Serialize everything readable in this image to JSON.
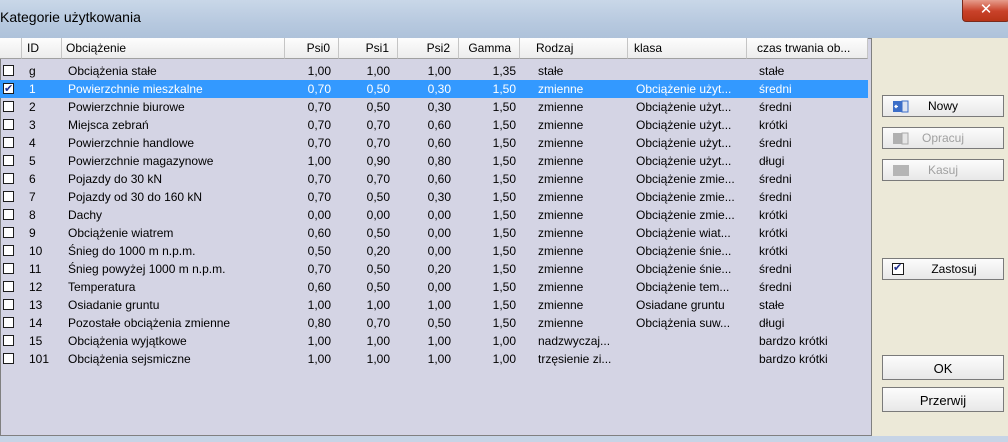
{
  "window": {
    "title": "Kategorie użytkowania",
    "close_symbol": "✕"
  },
  "table": {
    "columns": [
      {
        "key": "id",
        "label": "ID"
      },
      {
        "key": "name",
        "label": "Obciążenie"
      },
      {
        "key": "psi0",
        "label": "Psi0"
      },
      {
        "key": "psi1",
        "label": "Psi1"
      },
      {
        "key": "psi2",
        "label": "Psi2"
      },
      {
        "key": "gamma",
        "label": "Gamma"
      },
      {
        "key": "rodzaj",
        "label": "Rodzaj"
      },
      {
        "key": "klasa",
        "label": "klasa"
      },
      {
        "key": "czas",
        "label": "czas trwania ob..."
      }
    ],
    "rows": [
      {
        "checked": false,
        "selected": false,
        "id": "g",
        "name": "Obciążenia stałe",
        "psi0": "1,00",
        "psi1": "1,00",
        "psi2": "1,00",
        "gamma": "1,35",
        "rodzaj": "stałe",
        "klasa": "",
        "czas": "stałe"
      },
      {
        "checked": true,
        "selected": true,
        "id": "1",
        "name": "Powierzchnie mieszkalne",
        "psi0": "0,70",
        "psi1": "0,50",
        "psi2": "0,30",
        "gamma": "1,50",
        "rodzaj": "zmienne",
        "klasa": "Obciążenie użyt...",
        "czas": "średni"
      },
      {
        "checked": false,
        "selected": false,
        "id": "2",
        "name": "Powierzchnie biurowe",
        "psi0": "0,70",
        "psi1": "0,50",
        "psi2": "0,30",
        "gamma": "1,50",
        "rodzaj": "zmienne",
        "klasa": "Obciążenie użyt...",
        "czas": "średni"
      },
      {
        "checked": false,
        "selected": false,
        "id": "3",
        "name": "Miejsca zebrań",
        "psi0": "0,70",
        "psi1": "0,70",
        "psi2": "0,60",
        "gamma": "1,50",
        "rodzaj": "zmienne",
        "klasa": "Obciążenie użyt...",
        "czas": "krótki"
      },
      {
        "checked": false,
        "selected": false,
        "id": "4",
        "name": "Powierzchnie handlowe",
        "psi0": "0,70",
        "psi1": "0,70",
        "psi2": "0,60",
        "gamma": "1,50",
        "rodzaj": "zmienne",
        "klasa": "Obciążenie użyt...",
        "czas": "średni"
      },
      {
        "checked": false,
        "selected": false,
        "id": "5",
        "name": "Powierzchnie magazynowe",
        "psi0": "1,00",
        "psi1": "0,90",
        "psi2": "0,80",
        "gamma": "1,50",
        "rodzaj": "zmienne",
        "klasa": "Obciążenie użyt...",
        "czas": "długi"
      },
      {
        "checked": false,
        "selected": false,
        "id": "6",
        "name": "Pojazdy do 30 kN",
        "psi0": "0,70",
        "psi1": "0,70",
        "psi2": "0,60",
        "gamma": "1,50",
        "rodzaj": "zmienne",
        "klasa": "Obciążenie zmie...",
        "czas": "średni"
      },
      {
        "checked": false,
        "selected": false,
        "id": "7",
        "name": "Pojazdy od 30 do 160 kN",
        "psi0": "0,70",
        "psi1": "0,50",
        "psi2": "0,30",
        "gamma": "1,50",
        "rodzaj": "zmienne",
        "klasa": "Obciążenie zmie...",
        "czas": "średni"
      },
      {
        "checked": false,
        "selected": false,
        "id": "8",
        "name": "Dachy",
        "psi0": "0,00",
        "psi1": "0,00",
        "psi2": "0,00",
        "gamma": "1,50",
        "rodzaj": "zmienne",
        "klasa": "Obciążenie zmie...",
        "czas": "krótki"
      },
      {
        "checked": false,
        "selected": false,
        "id": "9",
        "name": "Obciążenie wiatrem",
        "psi0": "0,60",
        "psi1": "0,50",
        "psi2": "0,00",
        "gamma": "1,50",
        "rodzaj": "zmienne",
        "klasa": "Obciążenie wiat...",
        "czas": "krótki"
      },
      {
        "checked": false,
        "selected": false,
        "id": "10",
        "name": "Śnieg do 1000 m n.p.m.",
        "psi0": "0,50",
        "psi1": "0,20",
        "psi2": "0,00",
        "gamma": "1,50",
        "rodzaj": "zmienne",
        "klasa": "Obciążenie śnie...",
        "czas": "krótki"
      },
      {
        "checked": false,
        "selected": false,
        "id": "11",
        "name": "Śnieg powyżej 1000 m n.p.m.",
        "psi0": "0,70",
        "psi1": "0,50",
        "psi2": "0,20",
        "gamma": "1,50",
        "rodzaj": "zmienne",
        "klasa": "Obciążenie śnie...",
        "czas": "średni"
      },
      {
        "checked": false,
        "selected": false,
        "id": "12",
        "name": "Temperatura",
        "psi0": "0,60",
        "psi1": "0,50",
        "psi2": "0,00",
        "gamma": "1,50",
        "rodzaj": "zmienne",
        "klasa": "Obciążenie tem...",
        "czas": "średni"
      },
      {
        "checked": false,
        "selected": false,
        "id": "13",
        "name": "Osiadanie gruntu",
        "psi0": "1,00",
        "psi1": "1,00",
        "psi2": "1,00",
        "gamma": "1,50",
        "rodzaj": "zmienne",
        "klasa": "Osiadane gruntu",
        "czas": "stałe"
      },
      {
        "checked": false,
        "selected": false,
        "id": "14",
        "name": "Pozostałe obciążenia zmienne",
        "psi0": "0,80",
        "psi1": "0,70",
        "psi2": "0,50",
        "gamma": "1,50",
        "rodzaj": "zmienne",
        "klasa": "Obciążenia suw...",
        "czas": "długi"
      },
      {
        "checked": false,
        "selected": false,
        "id": "15",
        "name": "Obciążenia wyjątkowe",
        "psi0": "1,00",
        "psi1": "1,00",
        "psi2": "1,00",
        "gamma": "1,00",
        "rodzaj": "nadzwyczaj...",
        "klasa": "",
        "czas": "bardzo krótki"
      },
      {
        "checked": false,
        "selected": false,
        "id": "101",
        "name": "Obciążenia sejsmiczne",
        "psi0": "1,00",
        "psi1": "1,00",
        "psi2": "1,00",
        "gamma": "1,00",
        "rodzaj": "trzęsienie zi...",
        "klasa": "",
        "czas": "bardzo krótki"
      }
    ]
  },
  "buttons": {
    "nowy": "Nowy",
    "opracuj": "Opracuj",
    "kasuj": "Kasuj",
    "zastosuj": "Zastosuj",
    "ok": "OK",
    "przerwij": "Przerwij"
  }
}
